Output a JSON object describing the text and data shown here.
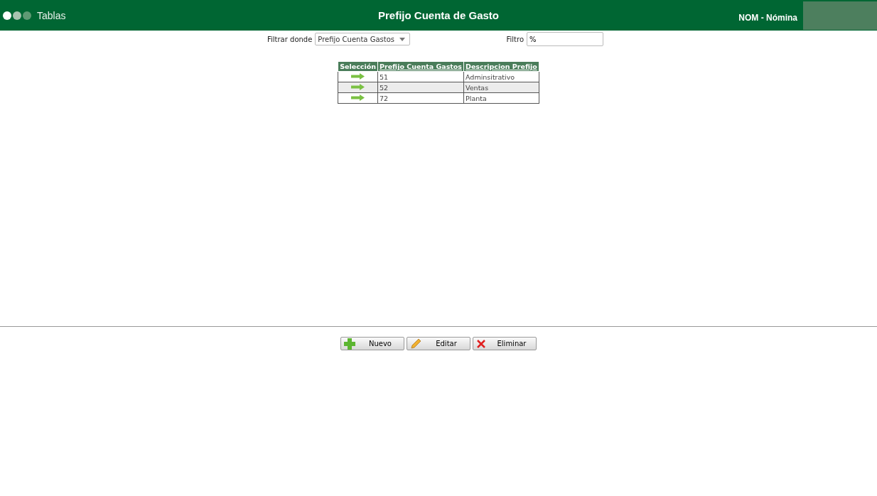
{
  "header": {
    "dots": [
      {
        "color": "#ffffff"
      },
      {
        "color": "#a8c4b0"
      },
      {
        "color": "#5f9a74"
      }
    ],
    "section": "Tablas",
    "title": "Prefijo Cuenta de Gasto",
    "module": "NOM - Nómina"
  },
  "filter": {
    "label": "Filtrar donde",
    "selected_field": "Prefijo Cuenta Gastos",
    "value_label": "Filtro",
    "value": "%"
  },
  "table": {
    "columns": [
      "Selección",
      "Prefijo Cuenta Gastos",
      "Descripcion Prefijo"
    ],
    "rows": [
      {
        "prefix": "51",
        "description": "Adminsitrativo"
      },
      {
        "prefix": "52",
        "description": "Ventas"
      },
      {
        "prefix": "72",
        "description": "Planta"
      }
    ]
  },
  "buttons": [
    {
      "kind": "add",
      "label": "Nuevo"
    },
    {
      "kind": "edit",
      "label": "Editar"
    },
    {
      "kind": "delete",
      "label": "Eliminar"
    }
  ]
}
